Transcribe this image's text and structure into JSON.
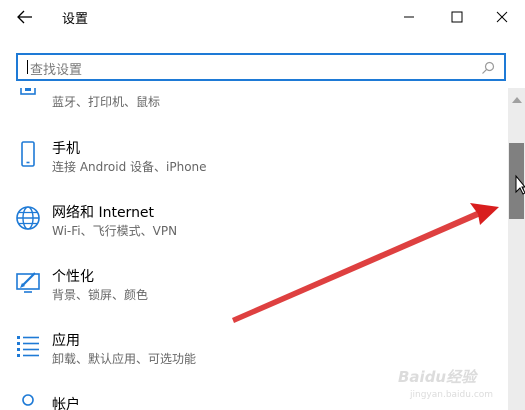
{
  "window": {
    "title": "设置",
    "back_icon": "back-arrow-icon",
    "minimize_icon": "minimize-icon",
    "maximize_icon": "maximize-icon",
    "close_icon": "close-icon"
  },
  "search": {
    "placeholder": "查找设置",
    "icon": "search-icon"
  },
  "items": [
    {
      "title": "",
      "subtitle": "蓝牙、打印机、鼠标",
      "icon": "devices-icon"
    },
    {
      "title": "手机",
      "subtitle": "连接 Android 设备、iPhone",
      "icon": "phone-icon"
    },
    {
      "title": "网络和 Internet",
      "subtitle": "Wi-Fi、飞行模式、VPN",
      "icon": "globe-icon"
    },
    {
      "title": "个性化",
      "subtitle": "背景、锁屏、颜色",
      "icon": "personalization-icon"
    },
    {
      "title": "应用",
      "subtitle": "卸载、默认应用、可选功能",
      "icon": "apps-icon"
    },
    {
      "title": "帐户",
      "subtitle": "",
      "icon": "account-icon"
    }
  ],
  "colors": {
    "accent": "#1e7ad6",
    "annotation": "#d81e1e",
    "scroll_thumb": "#808080"
  },
  "watermark": {
    "text": "Baidu经验",
    "sub": "jingyan.baidu.com"
  }
}
